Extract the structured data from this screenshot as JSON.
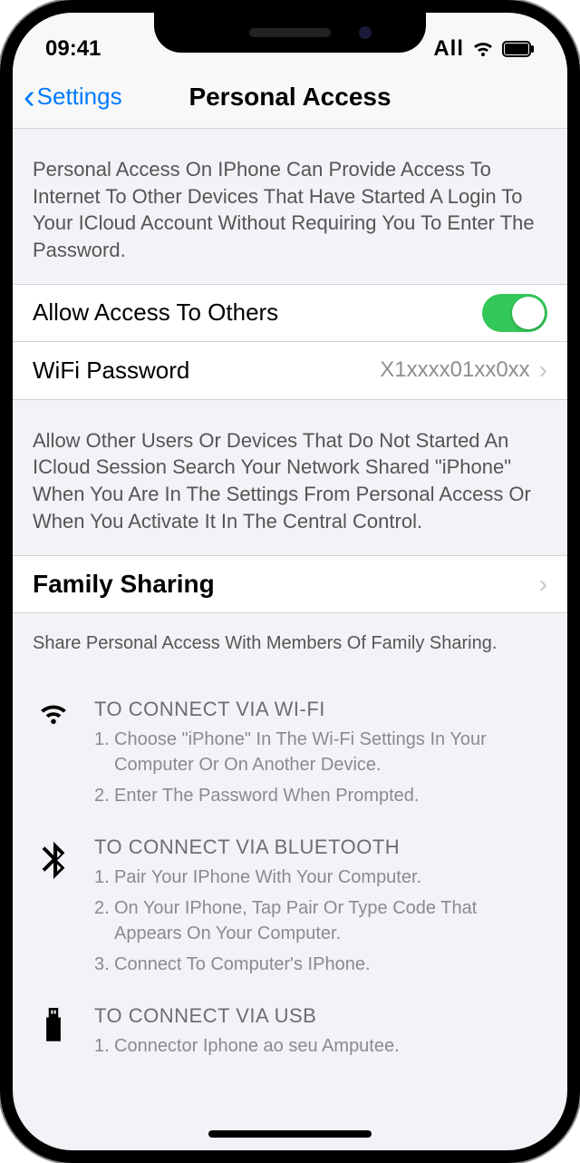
{
  "statusbar": {
    "time": "09:41",
    "carrier": "All"
  },
  "nav": {
    "back": "Settings",
    "title": "Personal Access"
  },
  "desc_top": "Personal Access On IPhone Can Provide Access To Internet To Other Devices That Have Started A Login To Your ICloud Account Without Requiring You To Enter The Password.",
  "rows": {
    "allow": {
      "label": "Allow Access To Others",
      "on": true
    },
    "wifi": {
      "label": "WiFi Password",
      "value": "X1xxxx01xx0xx"
    },
    "family": {
      "label": "Family Sharing"
    }
  },
  "desc_allow": "Allow Other Users Or Devices That Do Not Started An ICloud Session Search Your Network Shared \"iPhone\" When You Are In The Settings From Personal Access Or When You Activate It In The Central Control.",
  "desc_family": "Share Personal Access With Members Of Family Sharing.",
  "instructions": {
    "wifi": {
      "title": "TO CONNECT VIA WI-FI",
      "steps": [
        "Choose \"iPhone\" In The Wi-Fi Settings In Your Computer Or On Another Device.",
        "Enter The Password When Prompted."
      ]
    },
    "bt": {
      "title": "TO CONNECT VIA BLUETOOTH",
      "steps": [
        "Pair Your IPhone With Your Computer.",
        "On Your IPhone, Tap Pair Or Type Code That Appears On Your Computer.",
        "Connect To Computer's IPhone."
      ]
    },
    "usb": {
      "title": "TO CONNECT VIA USB",
      "steps": [
        "Connector Iphone ao seu Amputee."
      ]
    }
  }
}
